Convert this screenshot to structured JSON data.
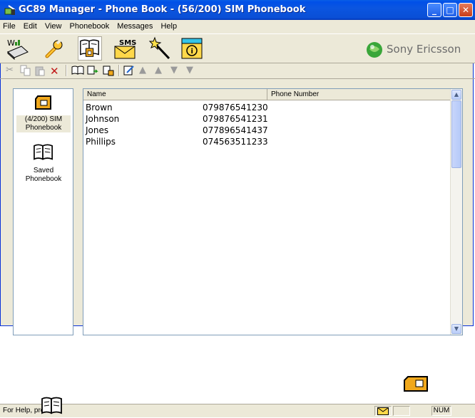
{
  "window": {
    "title": "GC89 Manager - Phone Book - (56/200) SIM Phonebook"
  },
  "menu": [
    "File",
    "Edit",
    "View",
    "Phonebook",
    "Messages",
    "Help"
  ],
  "big_toolbar": {
    "buttons": [
      {
        "icon": "wap-connection-icon"
      },
      {
        "icon": "wrench-settings-icon"
      },
      {
        "icon": "phonebook-icon",
        "active": true
      },
      {
        "icon": "sms-envelope-icon",
        "label": "SMS"
      },
      {
        "icon": "magic-wand-icon"
      },
      {
        "icon": "info-icon"
      }
    ],
    "brand": "Sony Ericsson"
  },
  "left_pane": {
    "items": [
      {
        "label_line1": "(4/200) SIM",
        "label_line2": "Phonebook",
        "selected": true
      },
      {
        "label_line1": "Saved",
        "label_line2": "Phonebook",
        "selected": false
      }
    ]
  },
  "list": {
    "columns": [
      "Name",
      "Phone Number"
    ],
    "rows": [
      {
        "name": "Brown",
        "phone": "079876541230"
      },
      {
        "name": "Johnson",
        "phone": "079876541231"
      },
      {
        "name": "Jones",
        "phone": "077896541437"
      },
      {
        "name": "Phillips",
        "phone": "074563511233"
      }
    ]
  },
  "status": {
    "help": "For Help, press F1",
    "num": "NUM"
  }
}
